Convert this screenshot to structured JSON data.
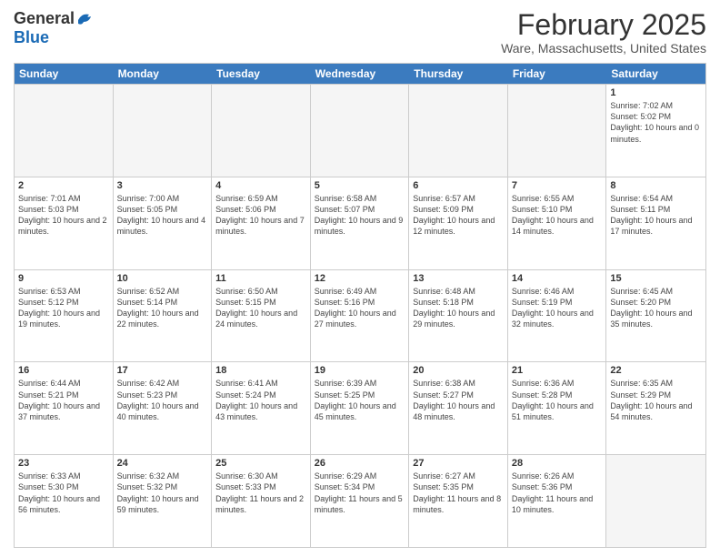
{
  "header": {
    "logo_general": "General",
    "logo_blue": "Blue",
    "month_title": "February 2025",
    "location": "Ware, Massachusetts, United States"
  },
  "weekdays": [
    "Sunday",
    "Monday",
    "Tuesday",
    "Wednesday",
    "Thursday",
    "Friday",
    "Saturday"
  ],
  "rows": [
    [
      {
        "day": "",
        "info": "",
        "empty": true
      },
      {
        "day": "",
        "info": "",
        "empty": true
      },
      {
        "day": "",
        "info": "",
        "empty": true
      },
      {
        "day": "",
        "info": "",
        "empty": true
      },
      {
        "day": "",
        "info": "",
        "empty": true
      },
      {
        "day": "",
        "info": "",
        "empty": true
      },
      {
        "day": "1",
        "info": "Sunrise: 7:02 AM\nSunset: 5:02 PM\nDaylight: 10 hours and 0 minutes.",
        "empty": false
      }
    ],
    [
      {
        "day": "2",
        "info": "Sunrise: 7:01 AM\nSunset: 5:03 PM\nDaylight: 10 hours and 2 minutes.",
        "empty": false
      },
      {
        "day": "3",
        "info": "Sunrise: 7:00 AM\nSunset: 5:05 PM\nDaylight: 10 hours and 4 minutes.",
        "empty": false
      },
      {
        "day": "4",
        "info": "Sunrise: 6:59 AM\nSunset: 5:06 PM\nDaylight: 10 hours and 7 minutes.",
        "empty": false
      },
      {
        "day": "5",
        "info": "Sunrise: 6:58 AM\nSunset: 5:07 PM\nDaylight: 10 hours and 9 minutes.",
        "empty": false
      },
      {
        "day": "6",
        "info": "Sunrise: 6:57 AM\nSunset: 5:09 PM\nDaylight: 10 hours and 12 minutes.",
        "empty": false
      },
      {
        "day": "7",
        "info": "Sunrise: 6:55 AM\nSunset: 5:10 PM\nDaylight: 10 hours and 14 minutes.",
        "empty": false
      },
      {
        "day": "8",
        "info": "Sunrise: 6:54 AM\nSunset: 5:11 PM\nDaylight: 10 hours and 17 minutes.",
        "empty": false
      }
    ],
    [
      {
        "day": "9",
        "info": "Sunrise: 6:53 AM\nSunset: 5:12 PM\nDaylight: 10 hours and 19 minutes.",
        "empty": false
      },
      {
        "day": "10",
        "info": "Sunrise: 6:52 AM\nSunset: 5:14 PM\nDaylight: 10 hours and 22 minutes.",
        "empty": false
      },
      {
        "day": "11",
        "info": "Sunrise: 6:50 AM\nSunset: 5:15 PM\nDaylight: 10 hours and 24 minutes.",
        "empty": false
      },
      {
        "day": "12",
        "info": "Sunrise: 6:49 AM\nSunset: 5:16 PM\nDaylight: 10 hours and 27 minutes.",
        "empty": false
      },
      {
        "day": "13",
        "info": "Sunrise: 6:48 AM\nSunset: 5:18 PM\nDaylight: 10 hours and 29 minutes.",
        "empty": false
      },
      {
        "day": "14",
        "info": "Sunrise: 6:46 AM\nSunset: 5:19 PM\nDaylight: 10 hours and 32 minutes.",
        "empty": false
      },
      {
        "day": "15",
        "info": "Sunrise: 6:45 AM\nSunset: 5:20 PM\nDaylight: 10 hours and 35 minutes.",
        "empty": false
      }
    ],
    [
      {
        "day": "16",
        "info": "Sunrise: 6:44 AM\nSunset: 5:21 PM\nDaylight: 10 hours and 37 minutes.",
        "empty": false
      },
      {
        "day": "17",
        "info": "Sunrise: 6:42 AM\nSunset: 5:23 PM\nDaylight: 10 hours and 40 minutes.",
        "empty": false
      },
      {
        "day": "18",
        "info": "Sunrise: 6:41 AM\nSunset: 5:24 PM\nDaylight: 10 hours and 43 minutes.",
        "empty": false
      },
      {
        "day": "19",
        "info": "Sunrise: 6:39 AM\nSunset: 5:25 PM\nDaylight: 10 hours and 45 minutes.",
        "empty": false
      },
      {
        "day": "20",
        "info": "Sunrise: 6:38 AM\nSunset: 5:27 PM\nDaylight: 10 hours and 48 minutes.",
        "empty": false
      },
      {
        "day": "21",
        "info": "Sunrise: 6:36 AM\nSunset: 5:28 PM\nDaylight: 10 hours and 51 minutes.",
        "empty": false
      },
      {
        "day": "22",
        "info": "Sunrise: 6:35 AM\nSunset: 5:29 PM\nDaylight: 10 hours and 54 minutes.",
        "empty": false
      }
    ],
    [
      {
        "day": "23",
        "info": "Sunrise: 6:33 AM\nSunset: 5:30 PM\nDaylight: 10 hours and 56 minutes.",
        "empty": false
      },
      {
        "day": "24",
        "info": "Sunrise: 6:32 AM\nSunset: 5:32 PM\nDaylight: 10 hours and 59 minutes.",
        "empty": false
      },
      {
        "day": "25",
        "info": "Sunrise: 6:30 AM\nSunset: 5:33 PM\nDaylight: 11 hours and 2 minutes.",
        "empty": false
      },
      {
        "day": "26",
        "info": "Sunrise: 6:29 AM\nSunset: 5:34 PM\nDaylight: 11 hours and 5 minutes.",
        "empty": false
      },
      {
        "day": "27",
        "info": "Sunrise: 6:27 AM\nSunset: 5:35 PM\nDaylight: 11 hours and 8 minutes.",
        "empty": false
      },
      {
        "day": "28",
        "info": "Sunrise: 6:26 AM\nSunset: 5:36 PM\nDaylight: 11 hours and 10 minutes.",
        "empty": false
      },
      {
        "day": "",
        "info": "",
        "empty": true
      }
    ]
  ]
}
